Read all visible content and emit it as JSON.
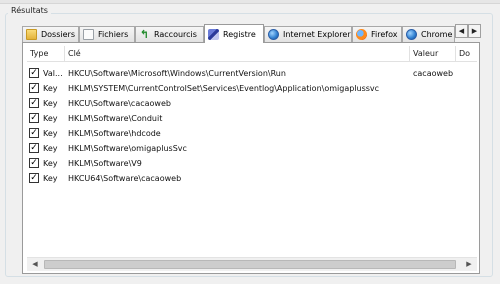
{
  "group_title": "Résultats",
  "tabs": [
    {
      "label": "Dossiers",
      "icon": "folder-icon"
    },
    {
      "label": "Fichiers",
      "icon": "file-icon"
    },
    {
      "label": "Raccourcis",
      "icon": "shortcut-arrow-icon"
    },
    {
      "label": "Registre",
      "icon": "registry-icon",
      "active": true
    },
    {
      "label": "Internet Explorer",
      "icon": "internet-explorer-icon"
    },
    {
      "label": "Firefox",
      "icon": "firefox-icon"
    },
    {
      "label": "Chrome",
      "icon": "chrome-icon"
    }
  ],
  "tab_nav": {
    "left": "◀",
    "right": "▶"
  },
  "columns": [
    "Type",
    "Clé",
    "Valeur",
    "Do"
  ],
  "rows": [
    {
      "checked": true,
      "type": "Val...",
      "key": "HKCU\\Software\\Microsoft\\Windows\\CurrentVersion\\Run",
      "value": "cacaoweb"
    },
    {
      "checked": true,
      "type": "Key",
      "key": "HKLM\\SYSTEM\\CurrentControlSet\\Services\\Eventlog\\Application\\omigaplussvc",
      "value": ""
    },
    {
      "checked": true,
      "type": "Key",
      "key": "HKCU\\Software\\cacaoweb",
      "value": ""
    },
    {
      "checked": true,
      "type": "Key",
      "key": "HKLM\\Software\\Conduit",
      "value": ""
    },
    {
      "checked": true,
      "type": "Key",
      "key": "HKLM\\Software\\hdcode",
      "value": ""
    },
    {
      "checked": true,
      "type": "Key",
      "key": "HKLM\\Software\\omigaplusSvc",
      "value": ""
    },
    {
      "checked": true,
      "type": "Key",
      "key": "HKLM\\Software\\V9",
      "value": ""
    },
    {
      "checked": true,
      "type": "Key",
      "key": "HKCU64\\Software\\cacaoweb",
      "value": ""
    }
  ],
  "checkbox_mark": "✓",
  "scroll_arrows": {
    "left": "◀",
    "right": "▶"
  }
}
